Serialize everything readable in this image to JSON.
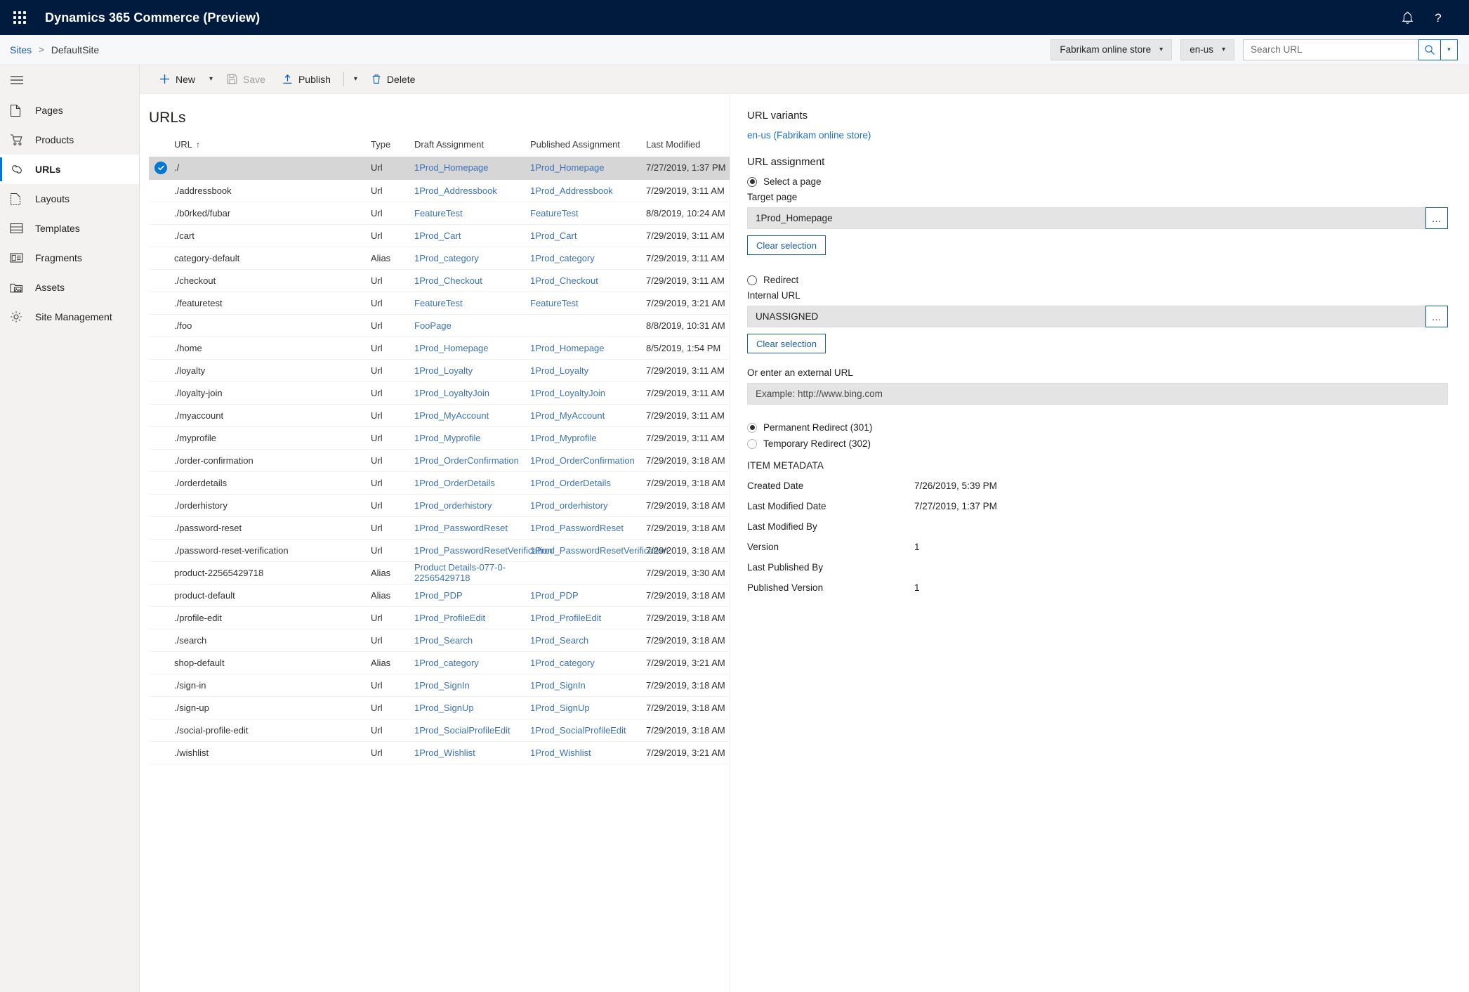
{
  "topbar": {
    "app_title": "Dynamics 365 Commerce (Preview)",
    "waffle_icon": "app-launcher-icon",
    "notification_icon": "bell-icon",
    "help_icon": "help-question-icon"
  },
  "cmdbar": {
    "breadcrumb": {
      "root": "Sites",
      "separator": ">",
      "current": "DefaultSite"
    },
    "channel_selector": "Fabrikam online store",
    "locale_selector": "en-us",
    "search": {
      "placeholder": "Search URL",
      "value": ""
    },
    "search_icon": "search-icon",
    "search_dropdown_icon": "chevron-down-icon"
  },
  "sidebar": {
    "hamburger_icon": "hamburger-menu-icon",
    "items": [
      {
        "label": "Pages",
        "icon": "page-icon",
        "active": false
      },
      {
        "label": "Products",
        "icon": "shopping-cart-icon",
        "active": false
      },
      {
        "label": "URLs",
        "icon": "link-chain-icon",
        "active": true
      },
      {
        "label": "Layouts",
        "icon": "layout-icon",
        "active": false
      },
      {
        "label": "Templates",
        "icon": "template-icon",
        "active": false
      },
      {
        "label": "Fragments",
        "icon": "fragment-icon",
        "active": false
      },
      {
        "label": "Assets",
        "icon": "asset-folder-icon",
        "active": false
      },
      {
        "label": "Site Management",
        "icon": "gear-icon",
        "active": false
      }
    ]
  },
  "toolbar": {
    "new_label": "New",
    "save_label": "Save",
    "publish_label": "Publish",
    "delete_label": "Delete",
    "new_icon": "plus-icon",
    "save_icon": "save-disk-icon",
    "publish_icon": "upload-arrow-icon",
    "delete_icon": "trash-icon",
    "caret_icon": "chevron-down-icon"
  },
  "main": {
    "page_title": "URLs",
    "table": {
      "columns": [
        "URL",
        "Type",
        "Draft Assignment",
        "Published Assignment",
        "Last Modified"
      ],
      "sort_column": "URL",
      "sort_indicator": "↑",
      "rows": [
        {
          "selected": true,
          "url": "./",
          "type": "Url",
          "draft": "1Prod_Homepage",
          "published": "1Prod_Homepage",
          "modified": "7/27/2019, 1:37 PM"
        },
        {
          "selected": false,
          "url": "./addressbook",
          "type": "Url",
          "draft": "1Prod_Addressbook",
          "published": "1Prod_Addressbook",
          "modified": "7/29/2019, 3:11 AM"
        },
        {
          "selected": false,
          "url": "./b0rked/fubar",
          "type": "Url",
          "draft": "FeatureTest",
          "published": "FeatureTest",
          "modified": "8/8/2019, 10:24 AM"
        },
        {
          "selected": false,
          "url": "./cart",
          "type": "Url",
          "draft": "1Prod_Cart",
          "published": "1Prod_Cart",
          "modified": "7/29/2019, 3:11 AM"
        },
        {
          "selected": false,
          "url": "category-default",
          "type": "Alias",
          "draft": "1Prod_category",
          "published": "1Prod_category",
          "modified": "7/29/2019, 3:11 AM"
        },
        {
          "selected": false,
          "url": "./checkout",
          "type": "Url",
          "draft": "1Prod_Checkout",
          "published": "1Prod_Checkout",
          "modified": "7/29/2019, 3:11 AM"
        },
        {
          "selected": false,
          "url": "./featuretest",
          "type": "Url",
          "draft": "FeatureTest",
          "published": "FeatureTest",
          "modified": "7/29/2019, 3:21 AM"
        },
        {
          "selected": false,
          "url": "./foo",
          "type": "Url",
          "draft": "FooPage",
          "published": "",
          "modified": "8/8/2019, 10:31 AM"
        },
        {
          "selected": false,
          "url": "./home",
          "type": "Url",
          "draft": "1Prod_Homepage",
          "published": "1Prod_Homepage",
          "modified": "8/5/2019, 1:54 PM"
        },
        {
          "selected": false,
          "url": "./loyalty",
          "type": "Url",
          "draft": "1Prod_Loyalty",
          "published": "1Prod_Loyalty",
          "modified": "7/29/2019, 3:11 AM"
        },
        {
          "selected": false,
          "url": "./loyalty-join",
          "type": "Url",
          "draft": "1Prod_LoyaltyJoin",
          "published": "1Prod_LoyaltyJoin",
          "modified": "7/29/2019, 3:11 AM"
        },
        {
          "selected": false,
          "url": "./myaccount",
          "type": "Url",
          "draft": "1Prod_MyAccount",
          "published": "1Prod_MyAccount",
          "modified": "7/29/2019, 3:11 AM"
        },
        {
          "selected": false,
          "url": "./myprofile",
          "type": "Url",
          "draft": "1Prod_Myprofile",
          "published": "1Prod_Myprofile",
          "modified": "7/29/2019, 3:11 AM"
        },
        {
          "selected": false,
          "url": "./order-confirmation",
          "type": "Url",
          "draft": "1Prod_OrderConfirmation",
          "published": "1Prod_OrderConfirmation",
          "modified": "7/29/2019, 3:18 AM"
        },
        {
          "selected": false,
          "url": "./orderdetails",
          "type": "Url",
          "draft": "1Prod_OrderDetails",
          "published": "1Prod_OrderDetails",
          "modified": "7/29/2019, 3:18 AM"
        },
        {
          "selected": false,
          "url": "./orderhistory",
          "type": "Url",
          "draft": "1Prod_orderhistory",
          "published": "1Prod_orderhistory",
          "modified": "7/29/2019, 3:18 AM"
        },
        {
          "selected": false,
          "url": "./password-reset",
          "type": "Url",
          "draft": "1Prod_PasswordReset",
          "published": "1Prod_PasswordReset",
          "modified": "7/29/2019, 3:18 AM"
        },
        {
          "selected": false,
          "url": "./password-reset-verification",
          "type": "Url",
          "draft": "1Prod_PasswordResetVerification",
          "published": "1Prod_PasswordResetVerification",
          "modified": "7/29/2019, 3:18 AM"
        },
        {
          "selected": false,
          "url": "product-22565429718",
          "type": "Alias",
          "draft": "Product Details-077-0-22565429718",
          "published": "",
          "modified": "7/29/2019, 3:30 AM"
        },
        {
          "selected": false,
          "url": "product-default",
          "type": "Alias",
          "draft": "1Prod_PDP",
          "published": "1Prod_PDP",
          "modified": "7/29/2019, 3:18 AM"
        },
        {
          "selected": false,
          "url": "./profile-edit",
          "type": "Url",
          "draft": "1Prod_ProfileEdit",
          "published": "1Prod_ProfileEdit",
          "modified": "7/29/2019, 3:18 AM"
        },
        {
          "selected": false,
          "url": "./search",
          "type": "Url",
          "draft": "1Prod_Search",
          "published": "1Prod_Search",
          "modified": "7/29/2019, 3:18 AM"
        },
        {
          "selected": false,
          "url": "shop-default",
          "type": "Alias",
          "draft": "1Prod_category",
          "published": "1Prod_category",
          "modified": "7/29/2019, 3:21 AM"
        },
        {
          "selected": false,
          "url": "./sign-in",
          "type": "Url",
          "draft": "1Prod_SignIn",
          "published": "1Prod_SignIn",
          "modified": "7/29/2019, 3:18 AM"
        },
        {
          "selected": false,
          "url": "./sign-up",
          "type": "Url",
          "draft": "1Prod_SignUp",
          "published": "1Prod_SignUp",
          "modified": "7/29/2019, 3:18 AM"
        },
        {
          "selected": false,
          "url": "./social-profile-edit",
          "type": "Url",
          "draft": "1Prod_SocialProfileEdit",
          "published": "1Prod_SocialProfileEdit",
          "modified": "7/29/2019, 3:18 AM"
        },
        {
          "selected": false,
          "url": "./wishlist",
          "type": "Url",
          "draft": "1Prod_Wishlist",
          "published": "1Prod_Wishlist",
          "modified": "7/29/2019, 3:21 AM"
        }
      ]
    }
  },
  "details": {
    "variants_heading": "URL variants",
    "variant_link": "en-us (Fabrikam online store)",
    "assignment_heading": "URL assignment",
    "select_page_radio": {
      "label": "Select a page",
      "checked": true
    },
    "target_page_label": "Target page",
    "target_page_value": "1Prod_Homepage",
    "target_page_ellipsis": "…",
    "clear_selection_1": "Clear selection",
    "redirect_radio": {
      "label": "Redirect",
      "checked": false
    },
    "internal_url_label": "Internal URL",
    "internal_url_value": "UNASSIGNED",
    "internal_url_ellipsis": "…",
    "clear_selection_2": "Clear selection",
    "external_url_label": "Or enter an external URL",
    "external_url_placeholder": "Example: http://www.bing.com",
    "permanent_redirect": {
      "label": "Permanent Redirect (301)",
      "checked": true
    },
    "temporary_redirect": {
      "label": "Temporary Redirect (302)",
      "checked": false
    },
    "metadata_heading": "ITEM METADATA",
    "metadata": [
      {
        "key": "Created Date",
        "value": "7/26/2019, 5:39 PM"
      },
      {
        "key": "Last Modified Date",
        "value": "7/27/2019, 1:37 PM"
      },
      {
        "key": "Last Modified By",
        "value": ""
      },
      {
        "key": "Version",
        "value": "1"
      },
      {
        "key": "Last Published By",
        "value": ""
      },
      {
        "key": "Published Version",
        "value": "1"
      }
    ]
  },
  "colors": {
    "topbar_bg": "#001b3d",
    "accent": "#0078d4",
    "link": "#3b72b8",
    "selected_row": "#d6d6d6",
    "sidebar_bg": "#f3f2f1"
  }
}
